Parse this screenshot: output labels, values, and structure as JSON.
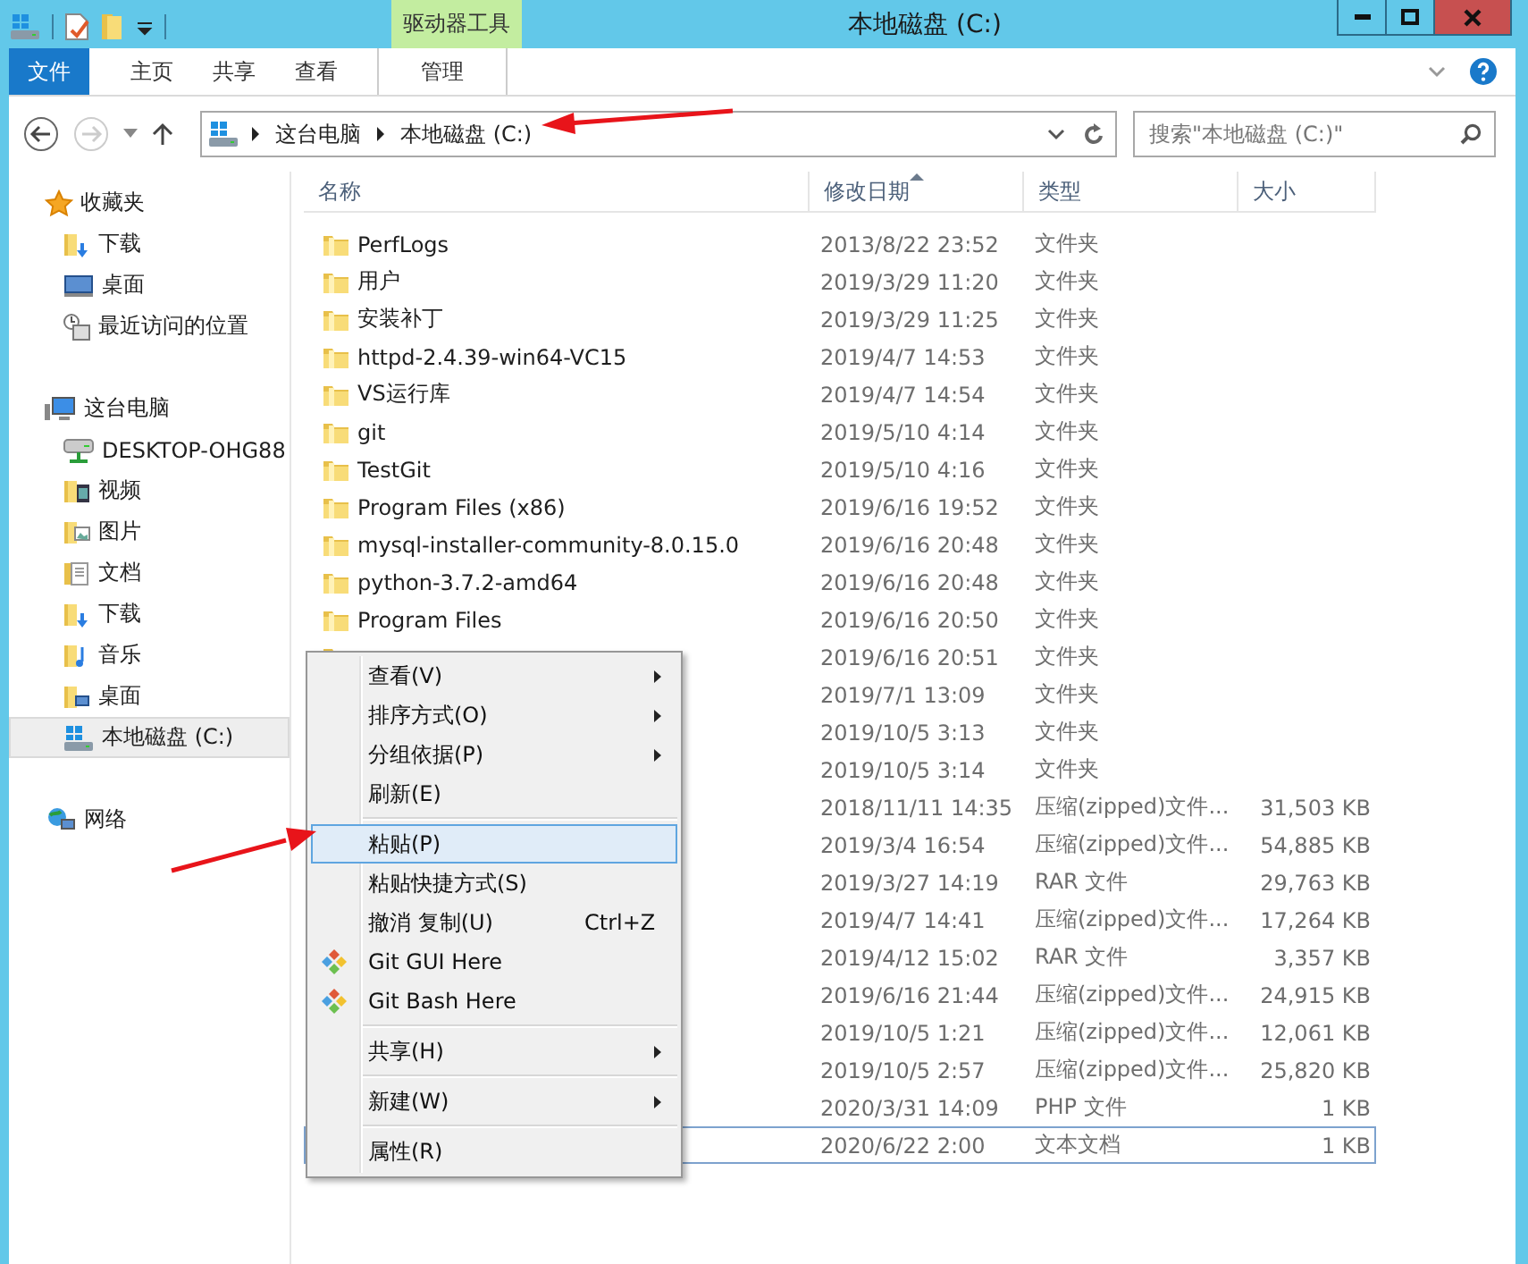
{
  "window": {
    "title": "本地磁盘 (C:)",
    "controls": [
      {
        "kind": "minimize"
      },
      {
        "kind": "maximize"
      },
      {
        "kind": "close"
      }
    ]
  },
  "ribbon": {
    "context_tab": "驱动器工具",
    "tabs": [
      {
        "label": "文件",
        "kind": "file",
        "selected": false
      },
      {
        "label": "主页",
        "kind": "tab",
        "selected": false
      },
      {
        "label": "共享",
        "kind": "tab",
        "selected": false
      },
      {
        "label": "查看",
        "kind": "tab",
        "selected": false
      },
      {
        "label": "管理",
        "kind": "context",
        "selected": false
      }
    ]
  },
  "address": {
    "path": [
      "这台电脑",
      "本地磁盘 (C:)"
    ]
  },
  "search": {
    "placeholder": "搜索\"本地磁盘 (C:)\""
  },
  "nav": {
    "groups": [
      {
        "label": "收藏夹",
        "kind": "star",
        "children": [
          {
            "label": "下载",
            "kind": "downloads",
            "selected": false
          },
          {
            "label": "桌面",
            "kind": "desktop",
            "selected": false
          },
          {
            "label": "最近访问的位置",
            "kind": "recent",
            "selected": false
          }
        ]
      },
      {
        "label": "这台电脑",
        "kind": "computer",
        "children": [
          {
            "label": "DESKTOP-OHG88",
            "kind": "netdrive",
            "selected": false
          },
          {
            "label": "视频",
            "kind": "videos",
            "selected": false
          },
          {
            "label": "图片",
            "kind": "pictures",
            "selected": false
          },
          {
            "label": "文档",
            "kind": "documents",
            "selected": false
          },
          {
            "label": "下载",
            "kind": "downloads",
            "selected": false
          },
          {
            "label": "音乐",
            "kind": "music",
            "selected": false
          },
          {
            "label": "桌面",
            "kind": "desktopfolder",
            "selected": false
          },
          {
            "label": "本地磁盘 (C:)",
            "kind": "drive",
            "selected": true
          }
        ]
      },
      {
        "label": "网络",
        "kind": "network"
      }
    ]
  },
  "file_list": {
    "columns": [
      {
        "label": "名称",
        "sorted": false
      },
      {
        "label": "修改日期",
        "sorted": true
      },
      {
        "label": "类型",
        "sorted": false
      },
      {
        "label": "大小",
        "sorted": false
      }
    ],
    "rows": [
      {
        "kind": "folder",
        "name": "PerfLogs",
        "date": "2013/8/22 23:52",
        "type": "文件夹",
        "focused": false
      },
      {
        "kind": "folder",
        "name": "用户",
        "date": "2019/3/29 11:20",
        "type": "文件夹",
        "focused": false
      },
      {
        "kind": "folder",
        "name": "安装补丁",
        "date": "2019/3/29 11:25",
        "type": "文件夹",
        "focused": false
      },
      {
        "kind": "folder",
        "name": "httpd-2.4.39-win64-VC15",
        "date": "2019/4/7 14:53",
        "type": "文件夹",
        "focused": false
      },
      {
        "kind": "folder",
        "name": "VS运行库",
        "date": "2019/4/7 14:54",
        "type": "文件夹",
        "focused": false
      },
      {
        "kind": "folder",
        "name": "git",
        "date": "2019/5/10 4:14",
        "type": "文件夹",
        "focused": false
      },
      {
        "kind": "folder",
        "name": "TestGit",
        "date": "2019/5/10 4:16",
        "type": "文件夹",
        "focused": false
      },
      {
        "kind": "folder",
        "name": "Program Files (x86)",
        "date": "2019/6/16 19:52",
        "type": "文件夹",
        "focused": false
      },
      {
        "kind": "folder",
        "name": "mysql-installer-community-8.0.15.0",
        "date": "2019/6/16 20:48",
        "type": "文件夹",
        "focused": false
      },
      {
        "kind": "folder",
        "name": "python-3.7.2-amd64",
        "date": "2019/6/16 20:48",
        "type": "文件夹",
        "focused": false
      },
      {
        "kind": "folder",
        "name": "Program Files",
        "date": "2019/6/16 20:50",
        "type": "文件夹",
        "focused": false
      },
      {
        "kind": "folder",
        "date": "2019/6/16 20:51",
        "type": "文件夹",
        "focused": false
      },
      {
        "date": "2019/7/1 13:09",
        "type": "文件夹",
        "focused": false
      },
      {
        "date": "2019/10/5 3:13",
        "type": "文件夹",
        "focused": false
      },
      {
        "date": "2019/10/5 3:14",
        "type": "文件夹",
        "focused": false
      },
      {
        "date": "2018/11/11 14:35",
        "type": "压缩(zipped)文件...",
        "size": "31,503 KB",
        "focused": false
      },
      {
        "date": "2019/3/4 16:54",
        "type": "压缩(zipped)文件...",
        "size": "54,885 KB",
        "focused": false
      },
      {
        "date": "2019/3/27 14:19",
        "type": "RAR 文件",
        "size": "29,763 KB",
        "focused": false
      },
      {
        "date": "2019/4/7 14:41",
        "type": "压缩(zipped)文件...",
        "size": "17,264 KB",
        "focused": false
      },
      {
        "date": "2019/4/12 15:02",
        "type": "RAR 文件",
        "size": "3,357 KB",
        "focused": false
      },
      {
        "date": "2019/6/16 21:44",
        "type": "压缩(zipped)文件...",
        "size": "24,915 KB",
        "focused": false
      },
      {
        "date": "2019/10/5 1:21",
        "type": "压缩(zipped)文件...",
        "size": "12,061 KB",
        "focused": false
      },
      {
        "date": "2019/10/5 2:57",
        "type": "压缩(zipped)文件...",
        "size": "25,820 KB",
        "focused": false
      },
      {
        "date": "2020/3/31 14:09",
        "type": "PHP 文件",
        "size": "1 KB",
        "focused": false
      },
      {
        "date": "2020/6/22 2:00",
        "type": "文本文档",
        "size": "1 KB",
        "focused": true
      }
    ]
  },
  "context_menu": {
    "items": [
      {
        "kind": "item",
        "label": "查看(V)",
        "submenu": true,
        "selected": false
      },
      {
        "kind": "item",
        "label": "排序方式(O)",
        "submenu": true,
        "selected": false
      },
      {
        "kind": "item",
        "label": "分组依据(P)",
        "submenu": true,
        "selected": false
      },
      {
        "kind": "item",
        "label": "刷新(E)",
        "submenu": false,
        "selected": false
      },
      {
        "kind": "separator"
      },
      {
        "kind": "item",
        "label": "粘贴(P)",
        "submenu": false,
        "selected": true
      },
      {
        "kind": "item",
        "label": "粘贴快捷方式(S)",
        "submenu": false,
        "selected": false
      },
      {
        "kind": "item",
        "label": "撤消 复制(U)",
        "shortcut": "Ctrl+Z",
        "submenu": false,
        "selected": false
      },
      {
        "kind": "git",
        "label": "Git GUI Here",
        "submenu": false,
        "selected": false
      },
      {
        "kind": "git",
        "label": "Git Bash Here",
        "submenu": false,
        "selected": false
      },
      {
        "kind": "separator"
      },
      {
        "kind": "item",
        "label": "共享(H)",
        "submenu": true,
        "selected": false
      },
      {
        "kind": "separator"
      },
      {
        "kind": "item",
        "label": "新建(W)",
        "submenu": true,
        "selected": false
      },
      {
        "kind": "separator"
      },
      {
        "kind": "item",
        "label": "属性(R)",
        "submenu": false,
        "selected": false
      }
    ]
  }
}
